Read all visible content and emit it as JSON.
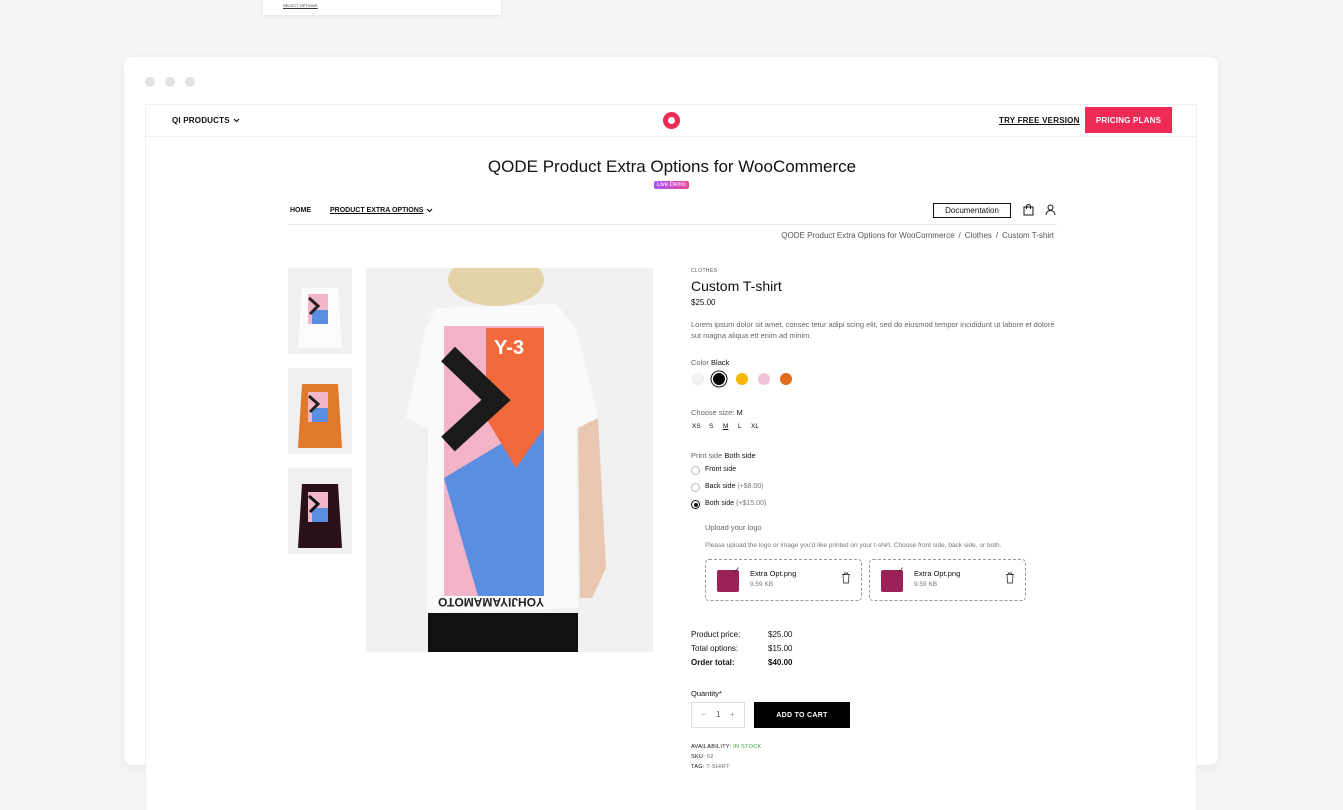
{
  "top_card": {
    "link": "SELECT OPTIONS"
  },
  "header": {
    "products_label": "QI PRODUCTS",
    "try_free": "TRY FREE VERSION",
    "pricing": "PRICING PLANS"
  },
  "site": {
    "title": "QODE Product Extra Options for WooCommerce",
    "badge": "Live Demo"
  },
  "nav": {
    "home": "HOME",
    "product_extra_options": "PRODUCT EXTRA OPTIONS",
    "documentation": "Documentation"
  },
  "breadcrumb": [
    "QODE Product Extra Options for WooCommerce",
    "Clothes",
    "Custom T-shirt"
  ],
  "breadcrumb_sep": "/",
  "product": {
    "category": "CLOTHES",
    "title": "Custom T-shirt",
    "price": "$25.00",
    "description": "Lorem ipsum dolor sit amet, consec tetur adipi scing elit, sed do eiusmod tempor incididunt ut labore et dolore sut magna aliqua ett enim ad minim."
  },
  "color": {
    "label": "Color",
    "selected": "Black",
    "swatches": [
      "#f3f3f3",
      "#000000",
      "#f5b800",
      "#f0c4d6",
      "#e06c1c"
    ]
  },
  "size": {
    "label": "Choose size:",
    "selected": "M",
    "options": [
      "XS",
      "S",
      "M",
      "L",
      "XL"
    ]
  },
  "print_side": {
    "label": "Print side",
    "selected": "Both side",
    "options": [
      {
        "label": "Front side",
        "extra": ""
      },
      {
        "label": "Back side",
        "extra": "(+$8.00)"
      },
      {
        "label": "Both side",
        "extra": "(+$15.00)"
      }
    ]
  },
  "upload": {
    "title": "Upload your logo",
    "desc": "Please upload the logo or image you'd like printed on your t-shirt. Choose front side, back side, or both.",
    "files": [
      {
        "name": "Extra Opt.png",
        "size": "9.59 KB"
      },
      {
        "name": "Extra Opt.png",
        "size": "9.59 KB"
      }
    ]
  },
  "totals": {
    "product_price_label": "Product price:",
    "product_price": "$25.00",
    "options_label": "Total options:",
    "options": "$15.00",
    "order_label": "Order total:",
    "order": "$40.00"
  },
  "quantity": {
    "label": "Quantity*",
    "value": "1",
    "minus": "−",
    "plus": "+"
  },
  "add_to_cart": "ADD TO CART",
  "meta": {
    "availability_label": "AVAILABILITY:",
    "availability": "IN STOCK",
    "sku_label": "SKU:",
    "sku": "02",
    "tag_label": "TAG:",
    "tag": "T-SHIRT"
  },
  "image_text": {
    "brand": "Y-3",
    "print": "YOHJIYAMAMOTO"
  }
}
